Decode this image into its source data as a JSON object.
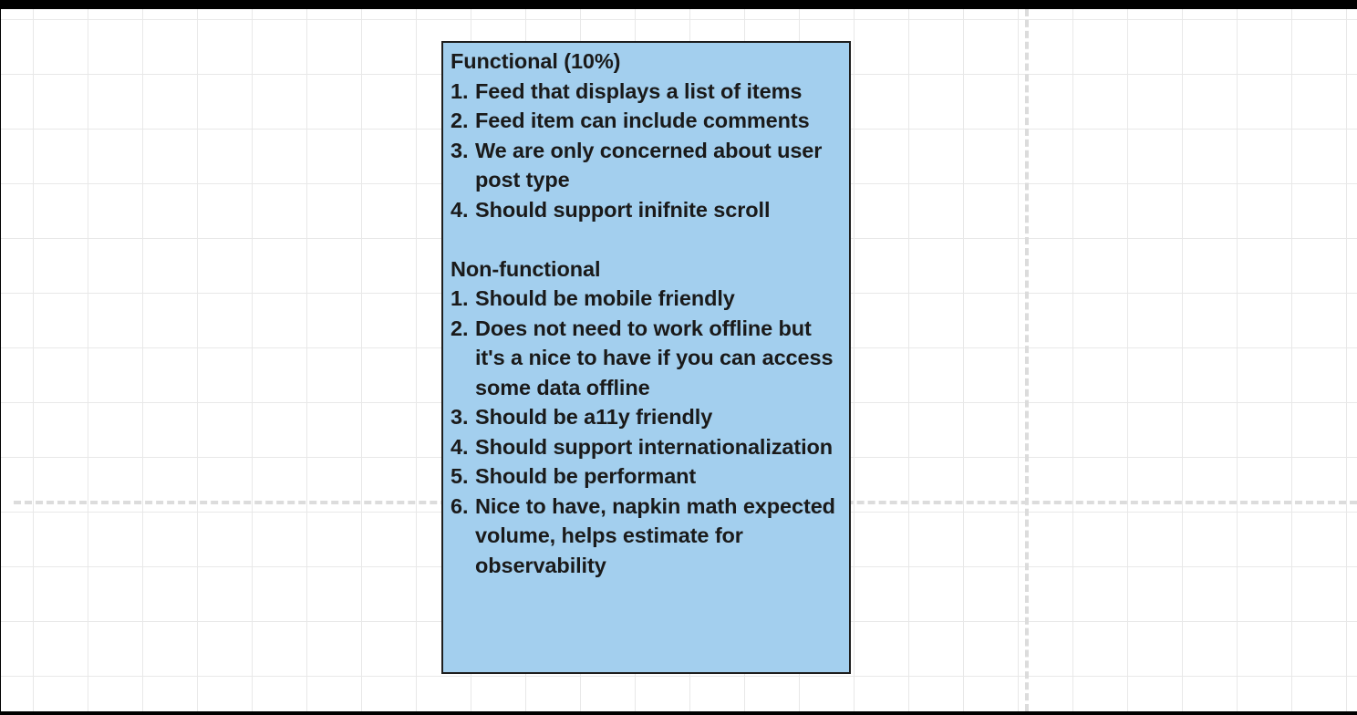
{
  "note": {
    "functional": {
      "heading": "Functional (10%)",
      "items": [
        {
          "num": "1.",
          "text": "Feed that displays a list of items"
        },
        {
          "num": "2.",
          "text": "Feed item can include comments"
        },
        {
          "num": "3.",
          "text": "We are only concerned about user post type"
        },
        {
          "num": "4.",
          "text": "Should support inifnite scroll"
        }
      ]
    },
    "non_functional": {
      "heading": "Non-functional",
      "items": [
        {
          "num": "1.",
          "text": "Should be mobile friendly"
        },
        {
          "num": "2.",
          "text": "Does not need to work offline but it's a nice to have if you can access some data offline"
        },
        {
          "num": "3.",
          "text": "Should be a11y friendly"
        },
        {
          "num": "4.",
          "text": "Should support internationalization"
        },
        {
          "num": "5.",
          "text": "Should be performant"
        },
        {
          "num": "6.",
          "text": "Nice to have, napkin math expected volume, helps estimate for observability"
        }
      ]
    }
  },
  "colors": {
    "note_fill": "#a3cfee",
    "note_border": "#1e1e1e",
    "grid_line": "#e8e8e8",
    "guide_line": "#dcdcdc"
  }
}
